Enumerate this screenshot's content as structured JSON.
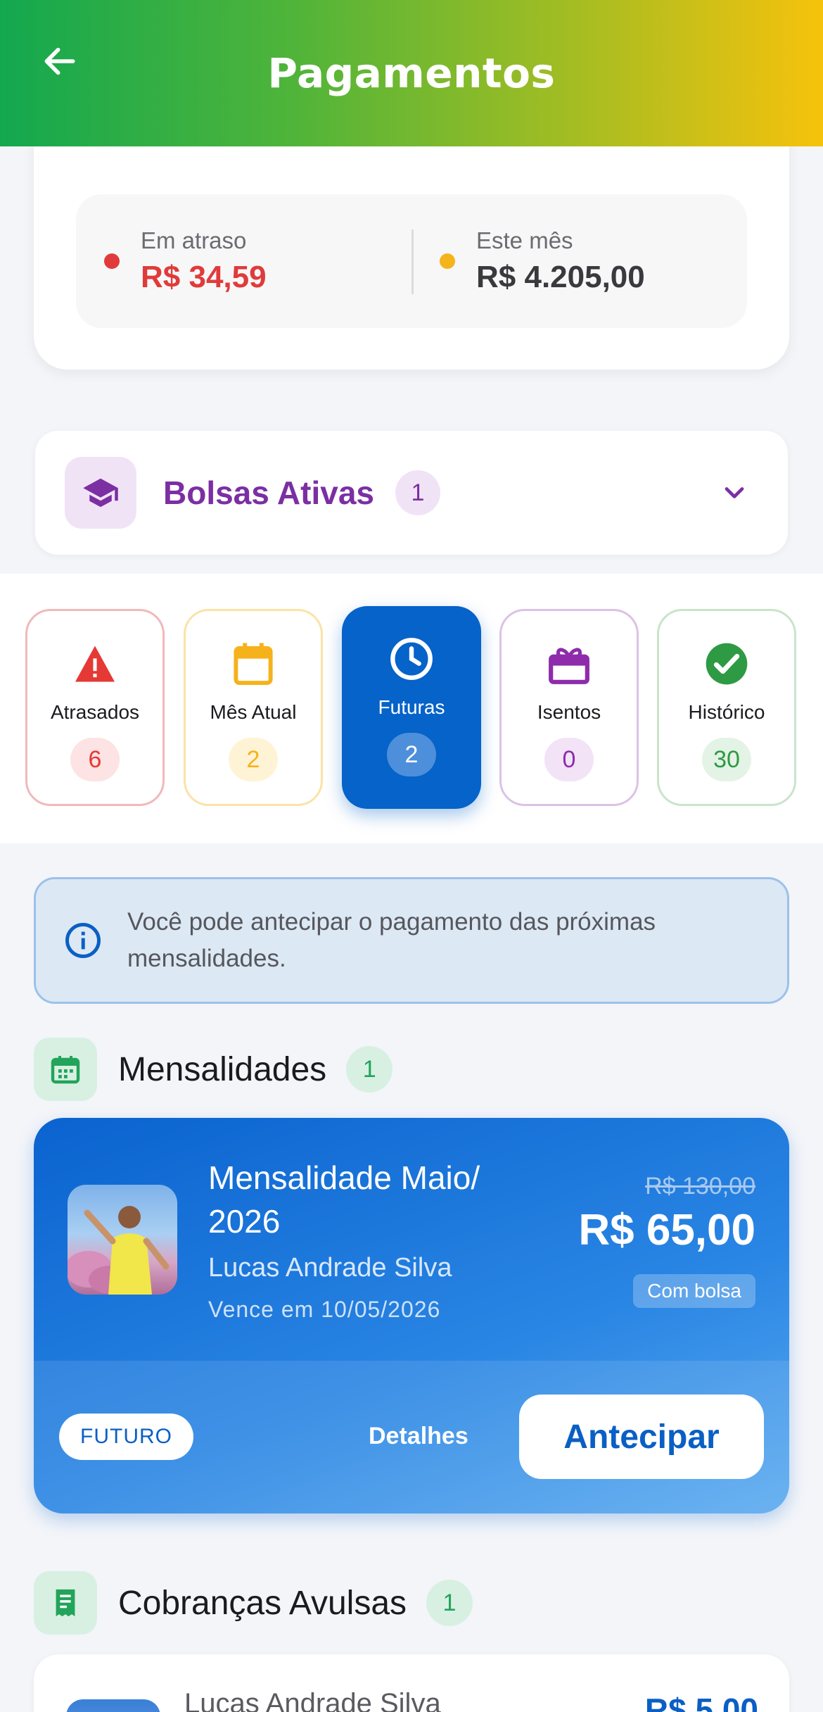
{
  "header": {
    "title": "Pagamentos"
  },
  "summary": {
    "overdue": {
      "label": "Em atraso",
      "value": "R$ 34,59",
      "color": "#e03b3b"
    },
    "month": {
      "label": "Este mês",
      "value": "R$ 4.205,00",
      "color": "#f4b41a"
    }
  },
  "bolsas": {
    "label": "Bolsas Ativas",
    "count": "1"
  },
  "filters": [
    {
      "label": "Atrasados",
      "count": "6",
      "icon": "warning-icon",
      "color": "#e53935"
    },
    {
      "label": "Mês Atual",
      "count": "2",
      "icon": "calendar-icon",
      "color": "#f6b21b"
    },
    {
      "label": "Futuras",
      "count": "2",
      "icon": "clock-icon",
      "color": "#0563c9",
      "active": true
    },
    {
      "label": "Isentos",
      "count": "0",
      "icon": "gift-icon",
      "color": "#8e2cab"
    },
    {
      "label": "Histórico",
      "count": "30",
      "icon": "check-circle-icon",
      "color": "#2f9a44"
    }
  ],
  "info": {
    "text": "Você pode antecipar o pagamento das próximas mensalidades."
  },
  "sections": {
    "mensalidades": {
      "title": "Mensalidades",
      "count": "1"
    },
    "avulsas": {
      "title": "Cobranças Avulsas",
      "count": "1"
    }
  },
  "mensalidade_card": {
    "title": "Mensalidade Maio/ 2026",
    "student": "Lucas Andrade Silva",
    "due": "Vence em 10/05/2026",
    "old_price": "R$ 130,00",
    "price": "R$ 65,00",
    "tag": "Com bolsa",
    "status": "FUTURO",
    "details_label": "Detalhes",
    "action_label": "Antecipar"
  },
  "avulsa_card": {
    "student": "Lucas Andrade Silva",
    "price": "R$ 5,00"
  }
}
